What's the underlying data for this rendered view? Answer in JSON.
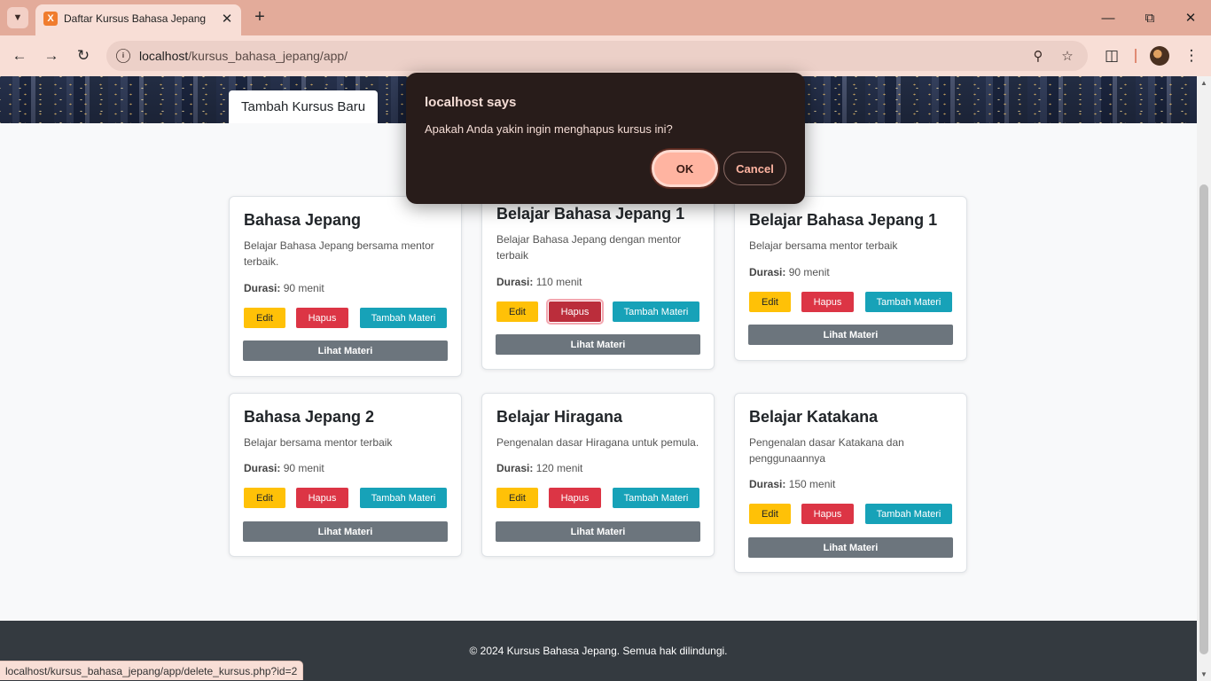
{
  "browser": {
    "tab_title": "Daftar Kursus Bahasa Jepang",
    "favicon_label": "X",
    "url_host": "localhost",
    "url_path": "/kursus_bahasa_jepang/app/",
    "status_link": "localhost/kursus_bahasa_jepang/app/delete_kursus.php?id=2"
  },
  "icons": {
    "tab_list": "chevron-down-icon",
    "close": "close-icon",
    "new_tab": "plus-icon",
    "back": "arrow-left-icon",
    "forward": "arrow-right-icon",
    "reload": "reload-icon",
    "site_info": "info-icon",
    "zoom": "zoom-out-icon",
    "bookmark": "star-icon",
    "extensions": "puzzle-icon",
    "menu": "kebab-menu-icon"
  },
  "header": {
    "add_course_tab": "Tambah Kursus Baru"
  },
  "labels": {
    "duration": "Durasi:",
    "edit": "Edit",
    "delete": "Hapus",
    "add_material": "Tambah Materi",
    "view_material": "Lihat Materi"
  },
  "courses": [
    {
      "title": "Bahasa Jepang",
      "description": "Belajar Bahasa Jepang bersama mentor terbaik.",
      "duration": "90 menit"
    },
    {
      "title": "Belajar Bahasa Jepang 1",
      "description": "Belajar Bahasa Jepang dengan mentor terbaik",
      "duration": "110 menit"
    },
    {
      "title": "Belajar Bahasa Jepang 1",
      "description": "Belajar bersama mentor terbaik",
      "duration": "90 menit"
    },
    {
      "title": "Bahasa Jepang 2",
      "description": "Belajar bersama mentor terbaik",
      "duration": "90 menit"
    },
    {
      "title": "Belajar Hiragana",
      "description": "Pengenalan dasar Hiragana untuk pemula.",
      "duration": "120 menit"
    },
    {
      "title": "Belajar Katakana",
      "description": "Pengenalan dasar Katakana dan penggunaannya",
      "duration": "150 menit"
    }
  ],
  "footer": {
    "text": "© 2024 Kursus Bahasa Jepang. Semua hak dilindungi."
  },
  "dialog": {
    "title": "localhost says",
    "message": "Apakah Anda yakin ingin menghapus kursus ini?",
    "ok": "OK",
    "cancel": "Cancel"
  },
  "colors": {
    "edit": "#ffc107",
    "delete": "#dc3545",
    "add_material": "#17a2b8",
    "view_material": "#6c757d",
    "footer": "#343a40",
    "dialog_bg": "#281c1a",
    "dialog_accent": "#ffb4a1"
  }
}
